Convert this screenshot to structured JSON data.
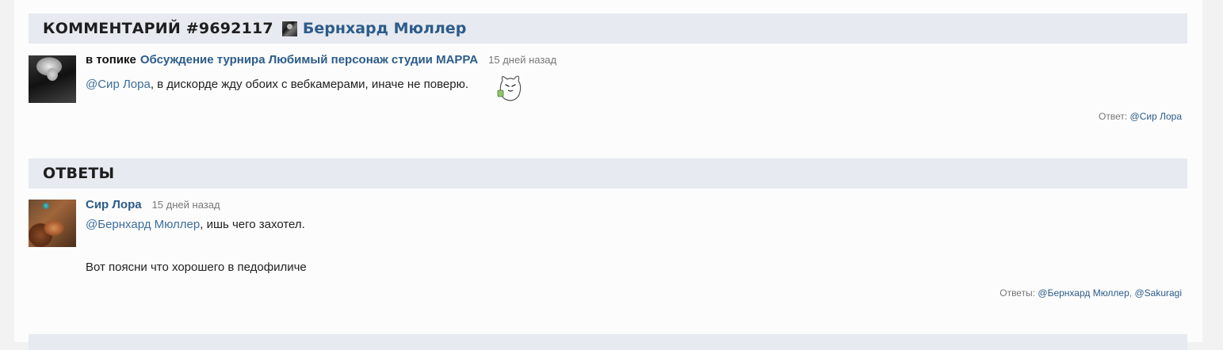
{
  "comment": {
    "header_prefix": "КОММЕНТАРИЙ #9692117",
    "author": "Бернхард Мюллер",
    "topic_prefix": "в топике",
    "topic_title": "Обсуждение турнира Любимый персонаж студии MAPPA",
    "time": "15 дней назад",
    "mention": "@Сир Лора",
    "text": ", в дискорде жду обоих с вебкамерами, иначе не поверю.",
    "reply_label": "Ответ:",
    "reply_user": "@Сир Лора",
    "emoji_icon": "cat-emoji-icon"
  },
  "answers": {
    "header": "ОТВЕТЫ",
    "items": [
      {
        "author": "Сир Лора",
        "time": "15 дней назад",
        "mention": "@Бернхард Мюллер",
        "text1": ", ишь чего захотел.",
        "text2": "Вот поясни что хорошего в педофиличе",
        "replies_label": "Ответы:",
        "reply_users": [
          "@Бернхард Мюллер",
          "@Sakuragi"
        ],
        "separator": ", "
      }
    ]
  },
  "colors": {
    "link": "#2c5c8a",
    "header_bg": "#e7eaf0",
    "muted": "#777777"
  }
}
